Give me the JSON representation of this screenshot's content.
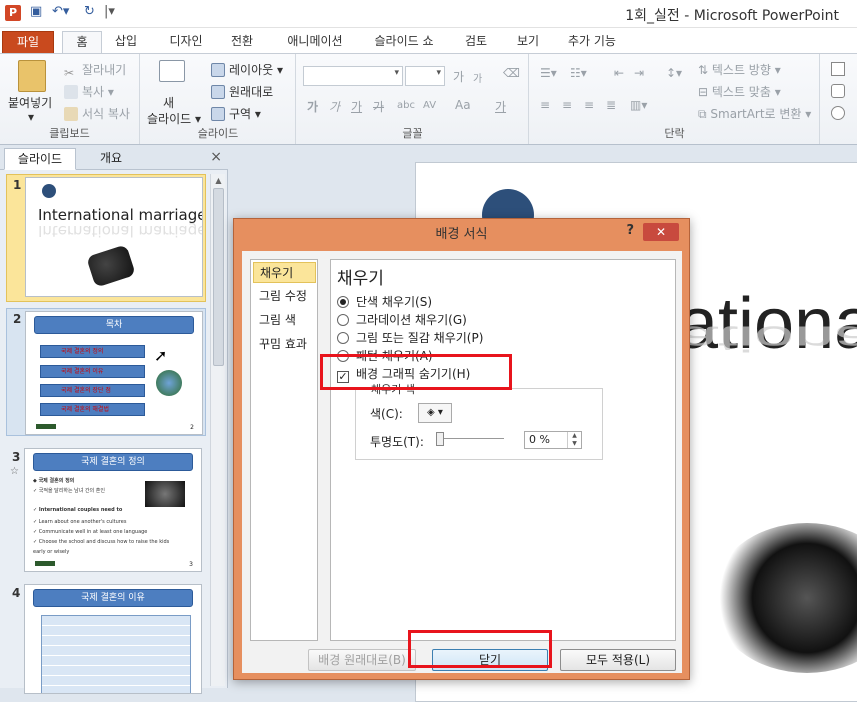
{
  "titlebar": {
    "app_icon": "P",
    "title": "1회_실전  -  Microsoft PowerPoint"
  },
  "tabs": [
    {
      "label": "파일"
    },
    {
      "label": "홈"
    },
    {
      "label": "삽입"
    },
    {
      "label": "디자인"
    },
    {
      "label": "전환"
    },
    {
      "label": "애니메이션"
    },
    {
      "label": "슬라이드 쇼"
    },
    {
      "label": "검토"
    },
    {
      "label": "보기"
    },
    {
      "label": "추가 기능"
    }
  ],
  "ribbon": {
    "clipboard": {
      "paste": "붙여넣기",
      "cut": "잘라내기",
      "copy": "복사",
      "format_painter": "서식 복사",
      "group": "클립보드"
    },
    "slides": {
      "new_slide": "새\n슬라이드",
      "layout": "레이아웃",
      "reset": "원래대로",
      "section": "구역",
      "group": "슬라이드"
    },
    "font": {
      "group": "글꼴",
      "grow": "가",
      "shrink": "가",
      "bold": "가",
      "italic": "가",
      "underline": "가",
      "strike": "가",
      "shadow": "abc",
      "spacing": "AV",
      "case": "Aa",
      "color": "가"
    },
    "paragraph": {
      "group": "단락",
      "text_direction": "텍스트 방향",
      "align_text": "텍스트 맞춤",
      "smartart": "SmartArt로 변환"
    }
  },
  "slide_panel": {
    "tab_slides": "슬라이드",
    "tab_outline": "개요",
    "close": "×",
    "thumbnails": [
      {
        "num": "1",
        "title": "International marriage"
      },
      {
        "num": "2",
        "title": "목차",
        "items": [
          "국제 결혼의 정의",
          "국제 결혼의 이유",
          "국제 결혼의 장단 점",
          "국제 결혼의 해결법"
        ],
        "page": "2"
      },
      {
        "num": "3",
        "title": "국제 결혼의 정의",
        "lines": [
          "◆ 국제 결혼의 정의",
          "✓ 국적을 달리하는 남녀 간의 혼인",
          "✓ International couples need to",
          "✓ Learn about one another's cultures",
          "✓ Communicate well in at least one language",
          "✓ Choose the school and discuss how to raise the kids",
          "early or wisely"
        ],
        "page": "3"
      },
      {
        "num": "4",
        "title": "국제 결혼의 이유"
      }
    ]
  },
  "slide": {
    "title_fragment": "ationa"
  },
  "dialog": {
    "title": "배경 서식",
    "help": "?",
    "close": "✕",
    "nav": [
      "채우기",
      "그림 수정",
      "그림 색",
      "꾸밈 효과"
    ],
    "heading": "채우기",
    "options": [
      {
        "label": "단색 채우기(S)",
        "type": "radio",
        "checked": true
      },
      {
        "label": "그라데이션 채우기(G)",
        "type": "radio",
        "checked": false
      },
      {
        "label": "그림 또는 질감 채우기(P)",
        "type": "radio",
        "checked": false
      },
      {
        "label": "패턴 채우기(A)",
        "type": "radio",
        "checked": false
      },
      {
        "label": "배경 그래픽 숨기기(H)",
        "type": "checkbox",
        "checked": true
      }
    ],
    "fill_color_legend": "채우기 색",
    "color_label": "색(C):",
    "transparency_label": "투명도(T):",
    "transparency_value": "0 %",
    "transparency": 0,
    "buttons": {
      "reset": "배경 원래대로(B)",
      "close": "닫기",
      "apply_all": "모두 적용(L)"
    }
  }
}
